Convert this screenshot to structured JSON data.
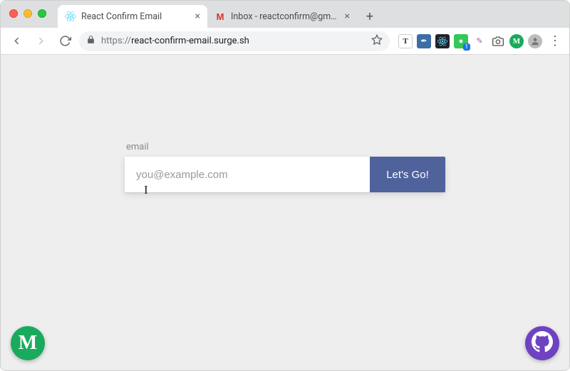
{
  "browser": {
    "tabs": [
      {
        "title": "React Confirm Email",
        "active": true,
        "favicon": "react-icon"
      },
      {
        "title": "Inbox - reactconfirm@gmail.co",
        "active": false,
        "favicon": "gmail-icon"
      }
    ],
    "address": {
      "scheme": "https://",
      "rest": "react-confirm-email.surge.sh"
    },
    "extensions": [
      {
        "name": "ext-t",
        "glyph": "T",
        "bg": "#ffffff",
        "fg": "#333"
      },
      {
        "name": "ext-pen",
        "glyph": "✒",
        "bg": "#3a6ea5",
        "fg": "#fff"
      },
      {
        "name": "ext-react-devtools",
        "glyph": "⚛",
        "bg": "#20232a",
        "fg": "#61dafb"
      },
      {
        "name": "ext-record",
        "glyph": "●",
        "bg": "#34c759",
        "fg": "#fff",
        "badge": "1"
      },
      {
        "name": "ext-feather",
        "glyph": "✎",
        "bg": "#ffffff",
        "fg": "#9b59b6"
      },
      {
        "name": "ext-camera",
        "glyph": "📷",
        "bg": "#ffffff",
        "fg": "#555"
      },
      {
        "name": "ext-m",
        "glyph": "M",
        "bg": "#1aaa5d",
        "fg": "#fff"
      }
    ]
  },
  "page": {
    "form": {
      "label": "email",
      "placeholder": "you@example.com",
      "button": "Let's Go!"
    },
    "badges": {
      "left_glyph": "M",
      "right": "github-icon"
    }
  }
}
